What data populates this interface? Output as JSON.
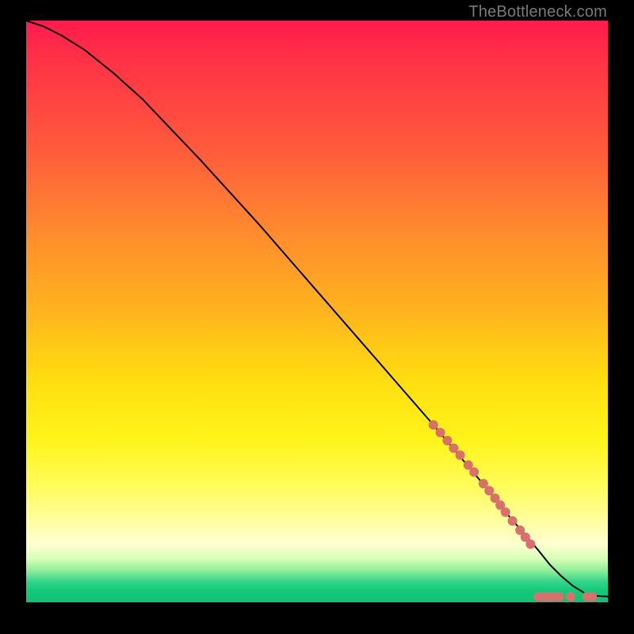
{
  "watermark": "TheBottleneck.com",
  "chart_data": {
    "type": "line",
    "title": "",
    "xlabel": "",
    "ylabel": "",
    "xlim": [
      0,
      100
    ],
    "ylim": [
      0,
      100
    ],
    "grid": false,
    "legend": false,
    "series": [
      {
        "name": "curve",
        "color": "#000000",
        "x": [
          0,
          3,
          6,
          10,
          15,
          20,
          30,
          40,
          50,
          60,
          70,
          78,
          82,
          85,
          88,
          90,
          92,
          94,
          96,
          98,
          100
        ],
        "y": [
          100,
          99,
          97.5,
          95,
          91,
          86.5,
          76,
          65,
          53.5,
          42,
          30.5,
          21,
          16,
          12.5,
          9,
          6.5,
          4.5,
          2.8,
          1.6,
          1.1,
          1
        ]
      }
    ],
    "markers": [
      {
        "name": "dots",
        "color": "#d9706b",
        "radius_px": 6,
        "points": [
          {
            "x": 70.0,
            "y": 30.5
          },
          {
            "x": 71.2,
            "y": 29.2
          },
          {
            "x": 72.4,
            "y": 27.8
          },
          {
            "x": 73.5,
            "y": 26.5
          },
          {
            "x": 74.6,
            "y": 25.3
          },
          {
            "x": 76.0,
            "y": 23.6
          },
          {
            "x": 77.0,
            "y": 22.4
          },
          {
            "x": 78.6,
            "y": 20.4
          },
          {
            "x": 79.6,
            "y": 19.2
          },
          {
            "x": 80.6,
            "y": 17.9
          },
          {
            "x": 81.5,
            "y": 16.7
          },
          {
            "x": 82.4,
            "y": 15.5
          },
          {
            "x": 83.6,
            "y": 14.0
          },
          {
            "x": 84.9,
            "y": 12.4
          },
          {
            "x": 85.8,
            "y": 11.2
          },
          {
            "x": 86.7,
            "y": 10.0
          },
          {
            "x": 88.0,
            "y": 1.0
          },
          {
            "x": 89.0,
            "y": 1.0
          },
          {
            "x": 90.0,
            "y": 1.0
          },
          {
            "x": 90.8,
            "y": 1.0
          },
          {
            "x": 91.6,
            "y": 1.0
          },
          {
            "x": 93.6,
            "y": 1.0
          },
          {
            "x": 96.4,
            "y": 1.0
          },
          {
            "x": 97.3,
            "y": 1.0
          }
        ]
      }
    ]
  }
}
